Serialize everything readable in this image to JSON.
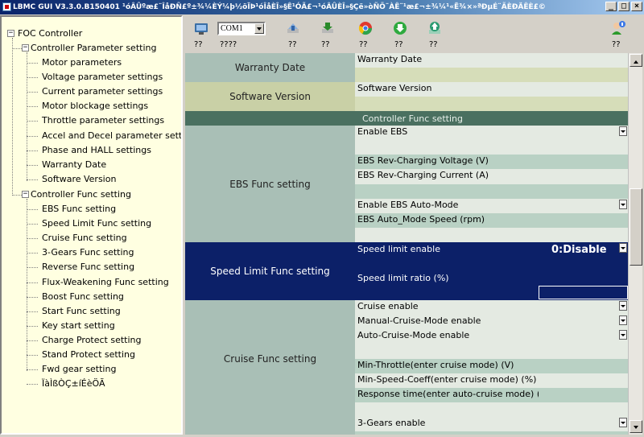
{
  "window": {
    "title": "LBMC GUI V3.3.0.B150401 ¹óÂÛºæ£¨ÎåÐÑ£º±¾¼ÈÝ¼þ½öÏÞ¹óÎåÈÎ»§Ê¹ÓÃ£¬¹óÂÛÈÎ»§Çë»òÑÖ¨ÀÊ¨¹æ£¬±¾¼¹«Ë¾×»ªÐµÉ¨ÃÈÐÄÊÈ£©",
    "minimize_glyph": "_",
    "maximize_glyph": "□",
    "close_glyph": "×"
  },
  "tree": {
    "root": "FOC Controller",
    "groups": [
      {
        "label": "Controller Parameter setting",
        "items": [
          "Motor parameters",
          "Voltage parameter settings",
          "Current parameter settings",
          "Motor blockage settings",
          "Throttle parameter settings",
          "Accel and Decel parameter settings",
          "Phase and HALL settings",
          "Warranty Date",
          "Software Version"
        ]
      },
      {
        "label": "Controller Func setting",
        "items": [
          "EBS Func setting",
          "Speed Limit Func setting",
          "Cruise Func setting",
          "3-Gears Func setting",
          "Reverse Func setting",
          "Flux-Weakening Func setting",
          "Boost Func setting",
          "Start Func setting",
          "Key start setting",
          "Charge Protect setting",
          "Stand Protect setting",
          "Fwd gear setting",
          "ÏàÌßÒÇ±íÉèÖÃ"
        ]
      }
    ]
  },
  "toolbar": {
    "com_port": "COM1",
    "buttons": [
      {
        "icon": "connect-icon",
        "caption": "??",
        "color": "#2266cc"
      },
      {
        "icon": "com-port",
        "caption": "????"
      },
      {
        "icon": "read-icon",
        "caption": "??",
        "color": "#3366aa"
      },
      {
        "icon": "write-icon",
        "caption": "??",
        "color": "#2a8a2a"
      },
      {
        "icon": "chrome-icon",
        "caption": "??",
        "color": "#d33"
      },
      {
        "icon": "download-icon",
        "caption": "??",
        "color": "#22a033"
      },
      {
        "icon": "upload-icon",
        "caption": "??",
        "color": "#229966"
      },
      {
        "icon": "user-icon",
        "caption": "??",
        "color": "#2a9a2a"
      }
    ]
  },
  "grid": {
    "colors": {
      "label_teal": "#a9bfb6",
      "label_olive": "#c9d0a6",
      "row_light": "#e4eae2",
      "row_green": "#b9d1c4",
      "row_olive": "#d6ddb9",
      "section_header": "#4a7060",
      "selected": "#0c2068"
    },
    "sections": {
      "warranty": {
        "group": "Warranty Date",
        "param": "Warranty Date"
      },
      "software": {
        "group": "Software Version",
        "param": "Software Version"
      },
      "func_header": "Controller Func setting",
      "ebs": {
        "group": "EBS Func setting",
        "params": [
          "Enable EBS",
          "",
          "EBS Rev-Charging Voltage (V)",
          "EBS Rev-Charging Current (A)",
          "",
          "Enable EBS Auto-Mode",
          "EBS Auto_Mode Speed (rpm)",
          ""
        ]
      },
      "speed_limit": {
        "group": "Speed Limit Func setting",
        "enable_label": "Speed limit enable",
        "enable_value": "0:Disable",
        "ratio_label": "Speed limit ratio (%)"
      },
      "cruise": {
        "group": "Cruise Func setting",
        "params": [
          "Cruise enable",
          "Manual-Cruise-Mode enable",
          "Auto-Cruise-Mode enable",
          "",
          "Min-Throttle(enter cruise mode) (V)",
          "Min-Speed-Coeff(enter cruise mode) (%)",
          "Response time(enter auto-cruise mode) (s)",
          ""
        ]
      },
      "gears": {
        "param": "3-Gears enable"
      }
    }
  }
}
